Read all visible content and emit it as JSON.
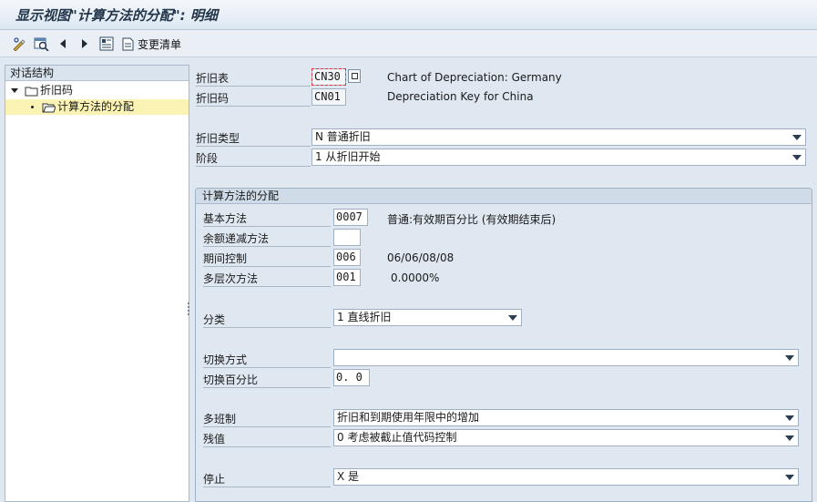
{
  "window": {
    "title": "显示视图\"计算方法的分配\": 明细"
  },
  "toolbar": {
    "change_list_label": "变更清单"
  },
  "tree": {
    "header": "对话结构",
    "items": [
      {
        "label": "折旧码"
      },
      {
        "label": "计算方法的分配"
      }
    ]
  },
  "top_fields": {
    "chart_label": "折旧表",
    "chart_value": "CN30",
    "chart_desc": "Chart of Depreciation: Germany",
    "key_label": "折旧码",
    "key_value": "CN01",
    "key_desc": "Depreciation Key for China",
    "dep_type_label": "折旧类型",
    "dep_type_value": "N 普通折旧",
    "phase_label": "阶段",
    "phase_value": "1 从折旧开始"
  },
  "group": {
    "title": "计算方法的分配",
    "base_method_label": "基本方法",
    "base_method_value": "0007",
    "base_method_desc": "普通:有效期百分比 (有效期结束后)",
    "declining_label": "余额递减方法",
    "declining_value": "",
    "period_label": "期间控制",
    "period_value": "006",
    "period_desc": "06/06/08/08",
    "multilevel_label": "多层次方法",
    "multilevel_value": "001",
    "multilevel_desc": "0.0000%",
    "class_label": "分类",
    "class_value": "1 直线折旧",
    "switch_label": "切换方式",
    "switch_value": "",
    "switch_pct_label": "切换百分比",
    "switch_pct_value": "0. 0",
    "shift_label": "多班制",
    "shift_value": "折旧和到期使用年限中的增加",
    "residual_label": "残值",
    "residual_value": "0 考虑被截止值代码控制",
    "stop_label": "停止",
    "stop_value": "X 是"
  }
}
